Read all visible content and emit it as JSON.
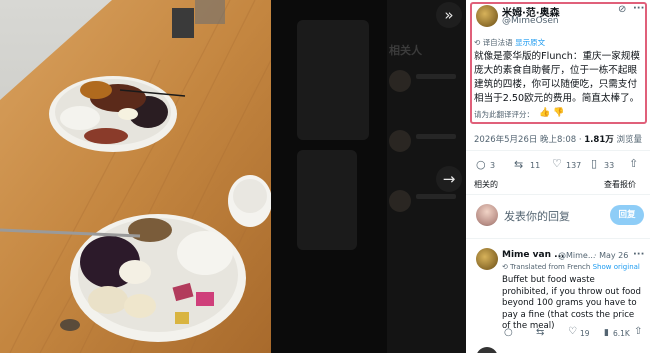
{
  "nav": {
    "collapse_icon": "double-chevron-right-icon",
    "next_icon": "arrow-right-icon"
  },
  "background_ghost": {
    "heading": "相关人"
  },
  "tweet": {
    "author_name": "米姆·范·奥森",
    "author_handle": "@MimeOsen",
    "translated_label": "译自法语",
    "show_original": "显示原文",
    "text": "就像是豪华版的Flunch：重庆一家规模庞大的素食自助餐厅，位于一栋不起眼建筑的四楼，你可以随便吃，只需支付相当于2.50欧元的费用。简直太棒了。",
    "rate_translation": "请为此翻译评分：",
    "timestamp": "2026年5月26日 晚上8:08",
    "views_count": "1.81万",
    "views_label": "浏览量",
    "replies": "3",
    "reposts": "11",
    "likes": "137",
    "bookmarks": "33",
    "related_label": "相关的",
    "view_quotes": "查看报价"
  },
  "reply_box": {
    "placeholder": "发表你的回复",
    "button": "回复"
  },
  "reply": {
    "author_name": "Mime van ...",
    "author_handle": "@Mime...",
    "date": "May 26",
    "translated_label": "Translated from French",
    "show_original": "Show original",
    "text": "Buffet but food waste prohibited, if you throw out food beyond 100 grams you have to pay a fine (that costs the price of the meal)",
    "replies": "",
    "reposts": "",
    "likes": "19",
    "views": "6.1K"
  },
  "colors": {
    "highlight": "#e0607a",
    "link": "#1d9bf0",
    "reply_button": "#8ecdf7",
    "table": "#c28a4a"
  }
}
